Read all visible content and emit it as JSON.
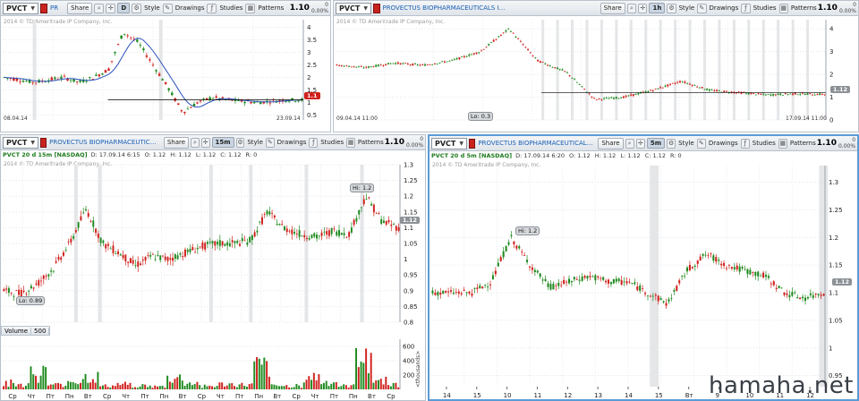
{
  "panes": [
    {
      "id": "p1",
      "symbol": "PVCT",
      "company": "PR",
      "agg": "D",
      "price": "1.10",
      "change": [
        "0",
        "0.00%"
      ],
      "buttons": [
        "Share",
        "Style",
        "Drawings",
        "Studies",
        "Patterns"
      ],
      "copyright": "2014 © TD Ameritrade IP Company, Inc.",
      "date_left": "08.04.14",
      "date_right": "23.09.14",
      "last": "1.1",
      "last_color": "#d0201c",
      "y_ticks": [
        "4",
        "3.5",
        "3",
        "2.5",
        "2",
        "1.5",
        "1",
        "0.5"
      ]
    },
    {
      "id": "p2",
      "symbol": "PVCT",
      "company": "PROVECTUS BIOPHARMACEUTICALS I.COM",
      "agg": "1h",
      "price": "1.10",
      "change": [
        "0",
        "0.00%"
      ],
      "buttons": [
        "Share",
        "Style",
        "Drawings",
        "Studies",
        "Patterns"
      ],
      "copyright": "2014 © TD Ameritrade IP Company, Inc.",
      "date_left": "09.04.14 11:00",
      "date_right": "17.09.14 11:00",
      "last": "1.12",
      "lo": "Lo: 0.3",
      "y_ticks": [
        "4",
        "3",
        "2",
        "1",
        "0"
      ]
    },
    {
      "id": "p3",
      "symbol": "PVCT",
      "company": "PROVECTUS BIOPHARMACEUTICALS I C...",
      "agg": "15m",
      "price": "1.10",
      "change": [
        "0",
        "0.00%"
      ],
      "buttons": [
        "Share",
        "Style",
        "Drawings",
        "Studies",
        "Patterns"
      ],
      "info": {
        "ticker": "PVCT 20 d 15m [NASDAQ]",
        "d": "D: 17.09.14 6:15",
        "o": "O: 1.12",
        "h": "H: 1.12",
        "l": "L: 1.12",
        "c": "C: 1.12",
        "r": "R: 0"
      },
      "copyright": "2014 © TD Ameritrade IP Company, Inc.",
      "hi": "Hi: 1.2",
      "lo": "Lo: 0.89",
      "last": "1.12",
      "y_ticks": [
        "1.3",
        "1.25",
        "1.2",
        "1.15",
        "1.1",
        "1.05",
        "1",
        "0.95",
        "0.9",
        "0.85",
        "0.8"
      ],
      "volume_label": "Volume",
      "volume_value": "500",
      "vol_ticks": [
        "600",
        "400",
        "200"
      ],
      "vol_axis": "<thousands>",
      "x_labels": [
        "Ср",
        "Чт",
        "Пт",
        "Пн",
        "Вт",
        "Ср",
        "Чт",
        "Пт",
        "Пн",
        "Вт",
        "Ср",
        "Чт",
        "Пт",
        "Пн",
        "Вт",
        "Ср",
        "Чт",
        "Пт",
        "Пн",
        "Вт",
        "Ср"
      ]
    },
    {
      "id": "p4",
      "symbol": "PVCT",
      "company": "PROVECTUS BIOPHARMACEUTICALS I C...",
      "agg": "5m",
      "price": "1.10",
      "change": [
        "0",
        "0.00%"
      ],
      "buttons": [
        "Share",
        "Style",
        "Drawings",
        "Studies",
        "Patterns"
      ],
      "info": {
        "ticker": "PVCT 20 d 5m [NASDAQ]",
        "d": "D: 17.09.14 6:20",
        "o": "O: 1.12",
        "h": "H: 1.12",
        "l": "L: 1.12",
        "c": "C: 1.12",
        "r": "R: 0"
      },
      "copyright": "2014 © TD Ameritrade IP Company, Inc.",
      "hi": "Hi: 1.2",
      "last": "1.12",
      "y_ticks": [
        "1.3",
        "1.25",
        "1.2",
        "1.15",
        "1.1",
        "1.05",
        "1",
        "0.95"
      ],
      "x_labels": [
        "14",
        "15",
        "10",
        "11",
        "12",
        "13",
        "14",
        "15",
        "Вт",
        "9",
        "10",
        "11",
        "12"
      ]
    }
  ],
  "watermark": "hamaha.net",
  "colors": {
    "up": "#1f8a1f",
    "down": "#d0201c",
    "avg": "#2a52be"
  },
  "chart_data": [
    {
      "type": "line",
      "title": "PVCT D",
      "x": [
        "08.04.14",
        "23.09.14"
      ],
      "series": [
        {
          "values": [
            2.0,
            1.9,
            1.8,
            1.9,
            2.0,
            1.8,
            2.0,
            2.3,
            3.8,
            3.4,
            2.5,
            1.6,
            0.6,
            1.0,
            1.2,
            1.1,
            1.05,
            1.0,
            1.05,
            1.1,
            1.1
          ]
        }
      ],
      "ylim": [
        0.3,
        4.3
      ]
    },
    {
      "type": "line",
      "title": "PVCT 1h",
      "x": [
        "09.04.14 11:00",
        "17.09.14 11:00"
      ],
      "series": [
        {
          "values": [
            2.4,
            2.3,
            2.5,
            2.4,
            2.6,
            3.0,
            4.0,
            2.6,
            2.1,
            0.9,
            1.0,
            1.3,
            1.7,
            1.3,
            1.2,
            1.1,
            1.15,
            1.12
          ]
        }
      ],
      "ylim": [
        0,
        4.4
      ]
    },
    {
      "type": "line",
      "title": "PVCT 20 d 15m",
      "x_labels_ref": "panes.2.x_labels",
      "series": [
        {
          "values": [
            0.9,
            0.89,
            0.92,
            0.97,
            1.05,
            1.16,
            1.05,
            1.02,
            0.98,
            1.01,
            1.0,
            1.02,
            1.04,
            1.05,
            1.05,
            1.06,
            1.15,
            1.1,
            1.08,
            1.07,
            1.09,
            1.08,
            1.2,
            1.12,
            1.1
          ]
        }
      ],
      "volume": [
        120,
        90,
        300,
        80,
        150,
        220,
        60,
        90,
        70,
        50,
        200,
        110,
        60,
        90,
        80,
        400,
        60,
        70,
        220,
        130,
        60,
        700,
        160,
        90
      ],
      "ylim": [
        0.8,
        1.3
      ]
    },
    {
      "type": "line",
      "title": "PVCT 20 d 5m",
      "x_labels_ref": "panes.3.x_labels",
      "series": [
        {
          "values": [
            1.1,
            1.1,
            1.1,
            1.12,
            1.2,
            1.15,
            1.11,
            1.12,
            1.13,
            1.12,
            1.12,
            1.1,
            1.08,
            1.14,
            1.17,
            1.15,
            1.14,
            1.13,
            1.1,
            1.09,
            1.1
          ]
        }
      ],
      "ylim": [
        0.93,
        1.33
      ]
    }
  ]
}
